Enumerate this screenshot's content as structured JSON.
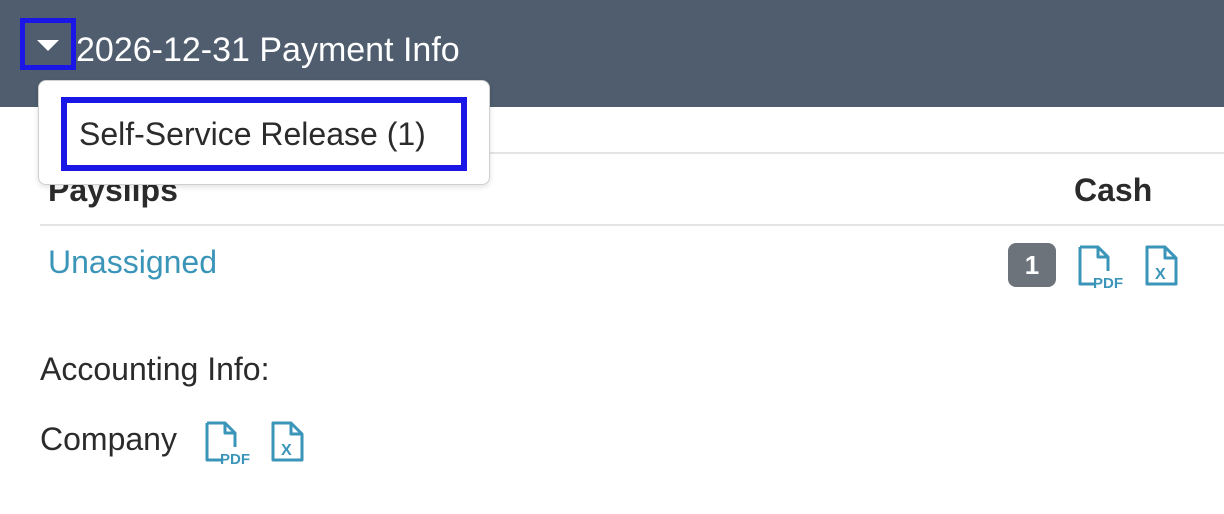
{
  "header": {
    "title": "2026-12-31 Payment Info",
    "toggle_icon": "caret-down-icon",
    "background": "#4f5d6e"
  },
  "dropdown": {
    "items": [
      {
        "label": "Self-Service Release (1)"
      }
    ]
  },
  "table": {
    "columns": [
      "Payslips",
      "Cash"
    ],
    "rows": [
      {
        "name": "Unassigned",
        "count": "1",
        "icons": [
          "pdf-file-icon",
          "excel-file-icon"
        ]
      }
    ]
  },
  "accounting": {
    "label": "Accounting Info:",
    "company_label": "Company",
    "icons": [
      "pdf-file-icon",
      "excel-file-icon"
    ]
  },
  "colors": {
    "link": "#3a95b8",
    "badge": "#6c737b",
    "highlight": "#1a17e6"
  },
  "icon_text": {
    "pdf": "PDF",
    "excel": "X"
  }
}
